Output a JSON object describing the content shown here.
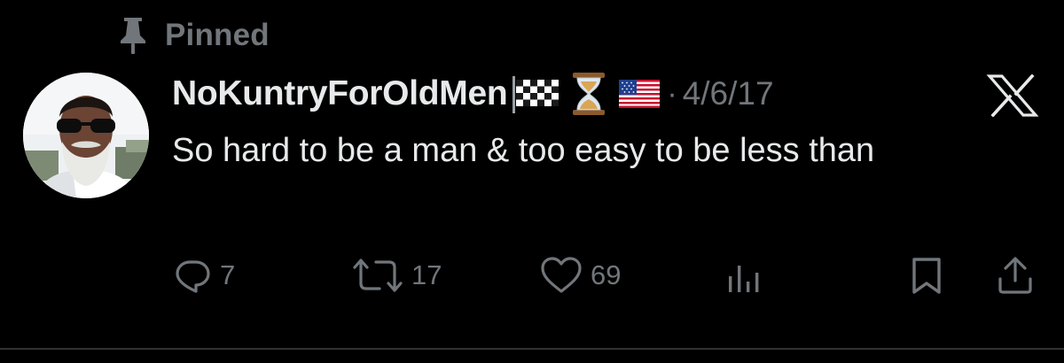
{
  "pinned": {
    "label": "Pinned",
    "icon": "pin-icon"
  },
  "author": {
    "display_name": "NoKuntryForOldMen",
    "avatar_icon": "avatar",
    "badges": [
      "checkered-flag-emoji",
      "hourglass-emoji",
      "us-flag-emoji"
    ]
  },
  "meta": {
    "separator": "·",
    "date": "4/6/17"
  },
  "tweet": {
    "text": "So hard to be a man & too easy to be less than"
  },
  "actions": {
    "reply": {
      "icon": "reply-icon",
      "count": "7"
    },
    "retweet": {
      "icon": "retweet-icon",
      "count": "17"
    },
    "like": {
      "icon": "heart-icon",
      "count": "69"
    },
    "views": {
      "icon": "views-icon"
    },
    "bookmark": {
      "icon": "bookmark-icon"
    },
    "share": {
      "icon": "share-icon"
    }
  },
  "colors": {
    "background": "#000000",
    "text_primary": "#e7e9ea",
    "text_secondary": "#71767b",
    "divider": "#2f3336"
  },
  "brand": {
    "logo": "x-logo-icon"
  }
}
